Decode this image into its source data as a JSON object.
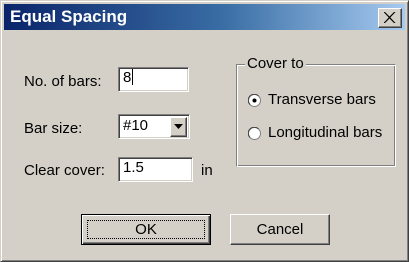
{
  "window": {
    "title": "Equal Spacing",
    "close_symbol": "×"
  },
  "fields": {
    "no_of_bars": {
      "label": "No. of bars:",
      "value": "8"
    },
    "bar_size": {
      "label": "Bar size:",
      "value": "#10"
    },
    "clear_cover": {
      "label": "Clear cover:",
      "value": "1.5",
      "unit": "in"
    }
  },
  "cover_to": {
    "label": "Cover to",
    "options": [
      {
        "label": "Transverse bars",
        "selected": true
      },
      {
        "label": "Longitudinal bars",
        "selected": false
      }
    ]
  },
  "buttons": {
    "ok": "OK",
    "cancel": "Cancel"
  },
  "icons": {
    "close": "close-icon",
    "dropdown": "chevron-down-icon",
    "radio_selected": "radio-selected-icon",
    "radio_unselected": "radio-unselected-icon"
  },
  "colors": {
    "titlebar_start": "#0a246a",
    "titlebar_end": "#a6caf0",
    "face": "#d4d0c8"
  }
}
